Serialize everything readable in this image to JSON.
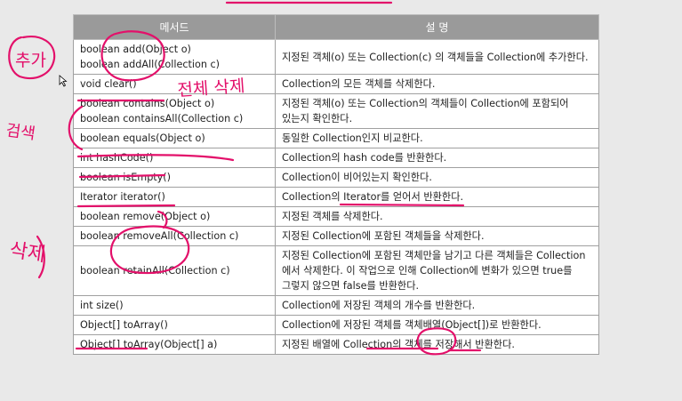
{
  "table": {
    "headers": {
      "method": "메서드",
      "description": "설 명"
    },
    "rows": [
      {
        "method": [
          "boolean add(Object o)",
          "boolean addAll(Collection c)"
        ],
        "description": [
          "지정된 객체(o) 또는 Collection(c) 의 객체들을 Collection에 추가한다."
        ]
      },
      {
        "method": [
          "void clear()"
        ],
        "description": [
          "Collection의 모든 객체를 삭제한다."
        ]
      },
      {
        "method": [
          "boolean contains(Object o)",
          "boolean containsAll(Collection c)"
        ],
        "description": [
          "지정된 객체(o) 또는 Collection의 객체들이 Collection에 포함되어 있는지 확인한다."
        ]
      },
      {
        "method": [
          "boolean equals(Object o)"
        ],
        "description": [
          "동일한 Collection인지 비교한다."
        ]
      },
      {
        "method": [
          "int hashCode()"
        ],
        "description": [
          "Collection의 hash code를 반환한다."
        ]
      },
      {
        "method": [
          "boolean isEmpty()"
        ],
        "description": [
          "Collection이 비어있는지 확인한다."
        ]
      },
      {
        "method": [
          "Iterator iterator()"
        ],
        "description": [
          "Collection의 Iterator를 얻어서 반환한다."
        ]
      },
      {
        "method": [
          "boolean remove(Object o)"
        ],
        "description": [
          "지정된 객체를 삭제한다."
        ]
      },
      {
        "method": [
          "boolean removeAll(Collection c)"
        ],
        "description": [
          "지정된 Collection에 포함된 객체들을 삭제한다."
        ]
      },
      {
        "method": [
          "boolean retainAll(Collection c)"
        ],
        "description": [
          "지정된 Collection에 포함된 객체만을 남기고 다른 객체들은 Collection 에서 삭제한다. 이 작업으로 인해 Collection에 변화가 있으면 true를 그렇지 않으면 false를 반환한다."
        ]
      },
      {
        "method": [
          "int size()"
        ],
        "description": [
          "Collection에 저장된 객체의 개수를 반환한다."
        ]
      },
      {
        "method": [
          "Object[] toArray()"
        ],
        "description": [
          "Collection에 저장된 객체를 객체배열(Object[])로 반환한다."
        ]
      },
      {
        "method": [
          "Object[] toArray(Object[] a)"
        ],
        "description": [
          "지정된 배열에 Collection의 객체를 저장해서 반환한다."
        ]
      }
    ]
  },
  "annotations": {
    "add_note": "추가",
    "clear_note": "전체 삭제",
    "search_note": "검색",
    "delete_note": "삭제"
  },
  "colors": {
    "ink": "#e3106a",
    "header_bg": "#9a9a9a",
    "page_bg": "#e9e9e9"
  }
}
